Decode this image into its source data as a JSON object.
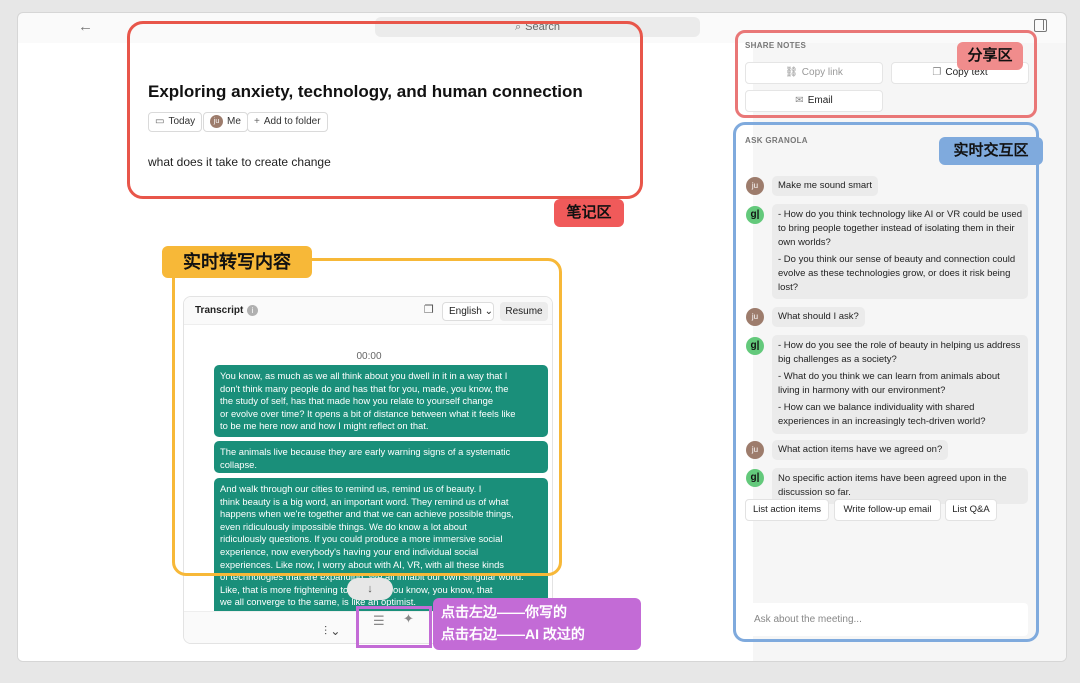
{
  "topbar": {
    "search_label": "Search"
  },
  "note": {
    "title": "Exploring anxiety, technology, and human connection",
    "chips": {
      "date": "Today",
      "avatar_initials": "ju",
      "person": "Me",
      "folder": "Add to folder"
    },
    "body": "what does it take to create change"
  },
  "annotations": {
    "notes_area": "笔记区",
    "transcript_area": "实时转写内容",
    "share_area": "分享区",
    "ask_area": "实时交互区",
    "toggle_hint_line1": "点击左边——你写的",
    "toggle_hint_line2": "点击右边——AI 改过的"
  },
  "transcript": {
    "title": "Transcript",
    "language": "English",
    "resume_label": "Resume",
    "timestamp": "00:00",
    "bubbles": [
      "You know, as much as we all think about you dwell in it in a way that I\ndon't think many people do and has that for you, made, you know, the\nthe study of self, has that made how you relate to yourself change\nor evolve over time? It opens a bit of distance between what it feels like\nto be me here now and how I might reflect on that.",
      "The animals live because they are early warning signs of a systematic\ncollapse.",
      "And walk through our cities to remind us, remind us of beauty. I\nthink beauty is a big word, an important word. They remind us of what\nhappens when we're together and that we can achieve possible things,\neven ridiculously impossible things. We do know a lot about\nridiculously questions. If you could produce a more immersive social\nexperience, now everybody's having your end individual social\nexperiences. Like now, I worry about with AI, VR, with all these kinds\nof technologies that are expanding. We all inhabit our own singular world.\nLike, that is more frightening to me, like, you know, you know, that\nwe all converge to the same, is like an optimist."
    ]
  },
  "share": {
    "label": "SHARE NOTES",
    "copy_link": "Copy link",
    "copy_text": "Copy text",
    "email": "Email"
  },
  "ask": {
    "label": "ASK GRANOLA",
    "user_initials": "ju",
    "bot_initial": "g|",
    "messages": [
      {
        "role": "user",
        "text": "Make me sound smart"
      },
      {
        "role": "bot",
        "items": [
          "- How do you think technology like AI or VR could be used to bring people together instead of isolating them in their own worlds?",
          "- Do you think our sense of beauty and connection could evolve as these technologies grow, or does it risk being lost?"
        ]
      },
      {
        "role": "user",
        "text": "What should I ask?"
      },
      {
        "role": "bot",
        "items": [
          "- How do you see the role of beauty in helping us address big challenges as a society?",
          "- What do you think we can learn from animals about living in harmony with our environment?",
          "- How can we balance individuality with shared experiences in an increasingly tech-driven world?"
        ]
      },
      {
        "role": "user",
        "text": "What action items have we agreed on?"
      },
      {
        "role": "bot",
        "items": [
          "No specific action items have been agreed upon in the discussion so far."
        ]
      }
    ],
    "actions": [
      "List action items",
      "Write follow-up email",
      "List Q&A"
    ],
    "input_placeholder": "Ask about the meeting..."
  }
}
